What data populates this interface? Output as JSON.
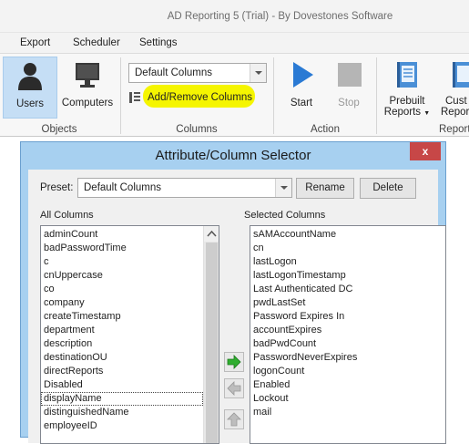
{
  "window": {
    "title": "AD Reporting 5 (Trial) - By Dovestones Software"
  },
  "menu": {
    "items": [
      "Export",
      "Scheduler",
      "Settings"
    ]
  },
  "ribbon": {
    "objects": {
      "users_label": "Users",
      "computers_label": "Computers",
      "group_label": "Objects"
    },
    "columns": {
      "preset_value": "Default Columns",
      "add_remove_label": "Add/Remove Columns",
      "group_label": "Columns"
    },
    "action": {
      "start_label": "Start",
      "stop_label": "Stop",
      "group_label": "Action"
    },
    "reports": {
      "prebuilt_line1": "Prebuilt",
      "prebuilt_line2": "Reports",
      "custom_line1": "Cust",
      "custom_line2": "Repor",
      "group_label": "Report"
    }
  },
  "dialog": {
    "title": "Attribute/Column Selector",
    "close_label": "x",
    "preset_label": "Preset:",
    "preset_value": "Default Columns",
    "rename_label": "Rename",
    "delete_label": "Delete",
    "all_columns_label": "All Columns",
    "selected_columns_label": "Selected Columns",
    "all_columns": [
      "adminCount",
      "badPasswordTime",
      "c",
      "cnUppercase",
      "co",
      "company",
      "createTimestamp",
      "department",
      "description",
      "destinationOU",
      "directReports",
      "Disabled",
      "displayName",
      "distinguishedName",
      "employeeID"
    ],
    "selected_index": 12,
    "selected_columns": [
      "sAMAccountName",
      "cn",
      "lastLogon",
      "lastLogonTimestamp",
      "Last Authenticated DC",
      "pwdLastSet",
      "Password Expires In",
      "accountExpires",
      "badPwdCount",
      "PasswordNeverExpires",
      "logonCount",
      "Enabled",
      "Lockout",
      "mail"
    ]
  },
  "colors": {
    "dialog_frame": "#a7d0f0",
    "close_button": "#c74747",
    "highlight": "#f5f500",
    "users_selected": "#c5def5",
    "add_arrow": "#2fae2f"
  }
}
